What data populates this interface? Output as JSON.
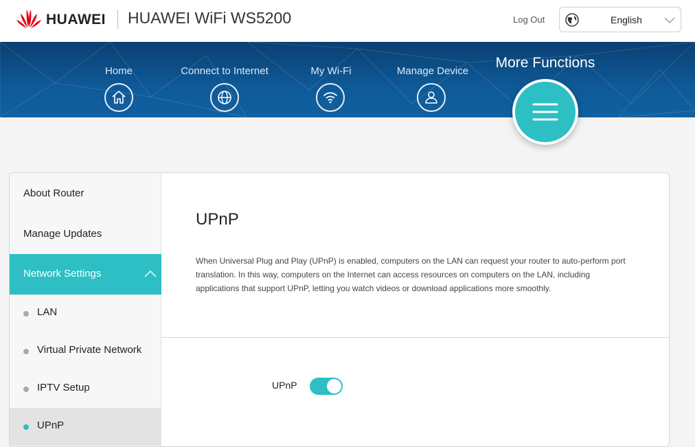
{
  "header": {
    "brand": "HUAWEI",
    "product": "HUAWEI WiFi WS5200",
    "logout_label": "Log Out",
    "language": {
      "selected": "English"
    }
  },
  "nav": {
    "items": [
      {
        "label": "Home",
        "icon": "home-icon"
      },
      {
        "label": "Connect to Internet",
        "icon": "globe-icon"
      },
      {
        "label": "My Wi-Fi",
        "icon": "wifi-icon"
      },
      {
        "label": "Manage Device",
        "icon": "user-icon"
      }
    ],
    "active": {
      "label": "More Functions",
      "icon": "menu-icon"
    }
  },
  "sidebar": {
    "top_items": [
      {
        "label": "About Router"
      },
      {
        "label": "Manage Updates"
      }
    ],
    "section": {
      "label": "Network Settings",
      "expanded": true
    },
    "sub_items": [
      {
        "label": "LAN",
        "selected": false
      },
      {
        "label": "Virtual Private Network",
        "selected": false
      },
      {
        "label": "IPTV Setup",
        "selected": false
      },
      {
        "label": "UPnP",
        "selected": true
      }
    ]
  },
  "content": {
    "title": "UPnP",
    "description": "When Universal Plug and Play (UPnP) is enabled, computers on the LAN can request your router to auto-perform port translation. In this way, computers on the Internet can access resources on computers on the LAN, including applications that support UPnP, letting you watch videos or download applications more smoothly.",
    "toggle_label": "UPnP",
    "toggle_on": true
  },
  "colors": {
    "accent": "#2dbfc4",
    "nav_bg": "#0e5a98",
    "brand_red": "#e60012"
  }
}
